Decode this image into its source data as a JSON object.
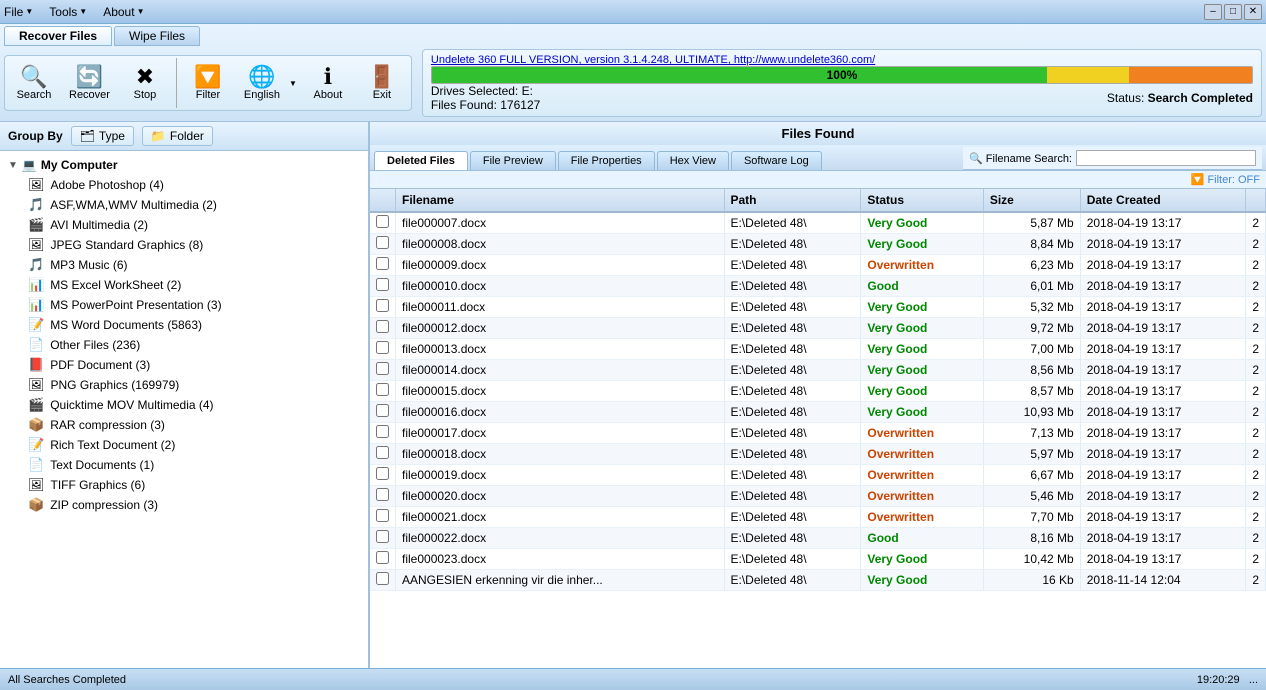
{
  "app": {
    "title": "Undelete 360",
    "version_link": "Undelete 360 FULL VERSION, version 3.1.4.248, ULTIMATE, http://www.undelete360.com/"
  },
  "menu": {
    "file": "File",
    "tools": "Tools",
    "about": "About"
  },
  "window_controls": {
    "minimize": "–",
    "maximize": "□",
    "close": "✕"
  },
  "tabs": {
    "recover_files": "Recover Files",
    "wipe_files": "Wipe Files"
  },
  "toolbar": {
    "search": "Search",
    "recover": "Recover",
    "stop": "Stop",
    "filter": "Filter",
    "language": "English",
    "about": "About",
    "exit": "Exit"
  },
  "status_panel": {
    "progress_percent": "100%",
    "drives_label": "Drives Selected: E:",
    "files_found_label": "Files Found: 176127",
    "status_label": "Status:",
    "status_value": "Search Completed"
  },
  "group_by": {
    "label": "Group By",
    "type_btn": "Type",
    "folder_btn": "Folder"
  },
  "tree": {
    "root": "My Computer",
    "items": [
      {
        "icon": "🖼",
        "label": "Adobe Photoshop (4)"
      },
      {
        "icon": "🎵",
        "label": "ASF,WMA,WMV Multimedia (2)"
      },
      {
        "icon": "🎬",
        "label": "AVI Multimedia (2)"
      },
      {
        "icon": "🖼",
        "label": "JPEG Standard Graphics (8)"
      },
      {
        "icon": "🎵",
        "label": "MP3 Music (6)"
      },
      {
        "icon": "📊",
        "label": "MS Excel WorkSheet (2)"
      },
      {
        "icon": "📊",
        "label": "MS PowerPoint Presentation (3)"
      },
      {
        "icon": "📝",
        "label": "MS Word Documents (5863)"
      },
      {
        "icon": "📄",
        "label": "Other Files (236)"
      },
      {
        "icon": "📕",
        "label": "PDF Document (3)"
      },
      {
        "icon": "🖼",
        "label": "PNG Graphics (169979)"
      },
      {
        "icon": "🎬",
        "label": "Quicktime MOV Multimedia (4)"
      },
      {
        "icon": "📦",
        "label": "RAR compression (3)"
      },
      {
        "icon": "📝",
        "label": "Rich Text Document (2)"
      },
      {
        "icon": "📄",
        "label": "Text Documents (1)"
      },
      {
        "icon": "🖼",
        "label": "TIFF Graphics (6)"
      },
      {
        "icon": "📦",
        "label": "ZIP compression (3)"
      }
    ]
  },
  "files_found_header": "Files Found",
  "panel_tabs": [
    {
      "label": "Deleted Files",
      "active": true
    },
    {
      "label": "File Preview",
      "active": false
    },
    {
      "label": "File Properties",
      "active": false
    },
    {
      "label": "Hex View",
      "active": false
    },
    {
      "label": "Software Log",
      "active": false
    }
  ],
  "search_bar": {
    "label": "🔍 Filename Search:",
    "placeholder": ""
  },
  "filter_bar": {
    "label": "🔽 Filter: OFF"
  },
  "table": {
    "columns": [
      "",
      "Filename",
      "Path",
      "Status",
      "Size",
      "Date Created",
      ""
    ],
    "rows": [
      {
        "filename": "file000007.docx",
        "path": "E:\\Deleted 48\\",
        "status": "Very Good",
        "status_class": "status-very-good",
        "size": "5,87 Mb",
        "date": "2018-04-19 13:17",
        "extra": "2"
      },
      {
        "filename": "file000008.docx",
        "path": "E:\\Deleted 48\\",
        "status": "Very Good",
        "status_class": "status-very-good",
        "size": "8,84 Mb",
        "date": "2018-04-19 13:17",
        "extra": "2"
      },
      {
        "filename": "file000009.docx",
        "path": "E:\\Deleted 48\\",
        "status": "Overwritten",
        "status_class": "status-overwritten",
        "size": "6,23 Mb",
        "date": "2018-04-19 13:17",
        "extra": "2"
      },
      {
        "filename": "file000010.docx",
        "path": "E:\\Deleted 48\\",
        "status": "Good",
        "status_class": "status-good",
        "size": "6,01 Mb",
        "date": "2018-04-19 13:17",
        "extra": "2"
      },
      {
        "filename": "file000011.docx",
        "path": "E:\\Deleted 48\\",
        "status": "Very Good",
        "status_class": "status-very-good",
        "size": "5,32 Mb",
        "date": "2018-04-19 13:17",
        "extra": "2"
      },
      {
        "filename": "file000012.docx",
        "path": "E:\\Deleted 48\\",
        "status": "Very Good",
        "status_class": "status-very-good",
        "size": "9,72 Mb",
        "date": "2018-04-19 13:17",
        "extra": "2"
      },
      {
        "filename": "file000013.docx",
        "path": "E:\\Deleted 48\\",
        "status": "Very Good",
        "status_class": "status-very-good",
        "size": "7,00 Mb",
        "date": "2018-04-19 13:17",
        "extra": "2"
      },
      {
        "filename": "file000014.docx",
        "path": "E:\\Deleted 48\\",
        "status": "Very Good",
        "status_class": "status-very-good",
        "size": "8,56 Mb",
        "date": "2018-04-19 13:17",
        "extra": "2"
      },
      {
        "filename": "file000015.docx",
        "path": "E:\\Deleted 48\\",
        "status": "Very Good",
        "status_class": "status-very-good",
        "size": "8,57 Mb",
        "date": "2018-04-19 13:17",
        "extra": "2"
      },
      {
        "filename": "file000016.docx",
        "path": "E:\\Deleted 48\\",
        "status": "Very Good",
        "status_class": "status-very-good",
        "size": "10,93 Mb",
        "date": "2018-04-19 13:17",
        "extra": "2"
      },
      {
        "filename": "file000017.docx",
        "path": "E:\\Deleted 48\\",
        "status": "Overwritten",
        "status_class": "status-overwritten",
        "size": "7,13 Mb",
        "date": "2018-04-19 13:17",
        "extra": "2"
      },
      {
        "filename": "file000018.docx",
        "path": "E:\\Deleted 48\\",
        "status": "Overwritten",
        "status_class": "status-overwritten",
        "size": "5,97 Mb",
        "date": "2018-04-19 13:17",
        "extra": "2"
      },
      {
        "filename": "file000019.docx",
        "path": "E:\\Deleted 48\\",
        "status": "Overwritten",
        "status_class": "status-overwritten",
        "size": "6,67 Mb",
        "date": "2018-04-19 13:17",
        "extra": "2"
      },
      {
        "filename": "file000020.docx",
        "path": "E:\\Deleted 48\\",
        "status": "Overwritten",
        "status_class": "status-overwritten",
        "size": "5,46 Mb",
        "date": "2018-04-19 13:17",
        "extra": "2"
      },
      {
        "filename": "file000021.docx",
        "path": "E:\\Deleted 48\\",
        "status": "Overwritten",
        "status_class": "status-overwritten",
        "size": "7,70 Mb",
        "date": "2018-04-19 13:17",
        "extra": "2"
      },
      {
        "filename": "file000022.docx",
        "path": "E:\\Deleted 48\\",
        "status": "Good",
        "status_class": "status-good",
        "size": "8,16 Mb",
        "date": "2018-04-19 13:17",
        "extra": "2"
      },
      {
        "filename": "file000023.docx",
        "path": "E:\\Deleted 48\\",
        "status": "Very Good",
        "status_class": "status-very-good",
        "size": "10,42 Mb",
        "date": "2018-04-19 13:17",
        "extra": "2"
      },
      {
        "filename": "AANGESIEN erkenning vir die inher...",
        "path": "E:\\Deleted 48\\",
        "status": "Very Good",
        "status_class": "status-very-good",
        "size": "16 Kb",
        "date": "2018-11-14 12:04",
        "extra": "2"
      }
    ]
  },
  "status_bar": {
    "left": "All Searches Completed",
    "right": "19:20:29",
    "extra": "..."
  }
}
